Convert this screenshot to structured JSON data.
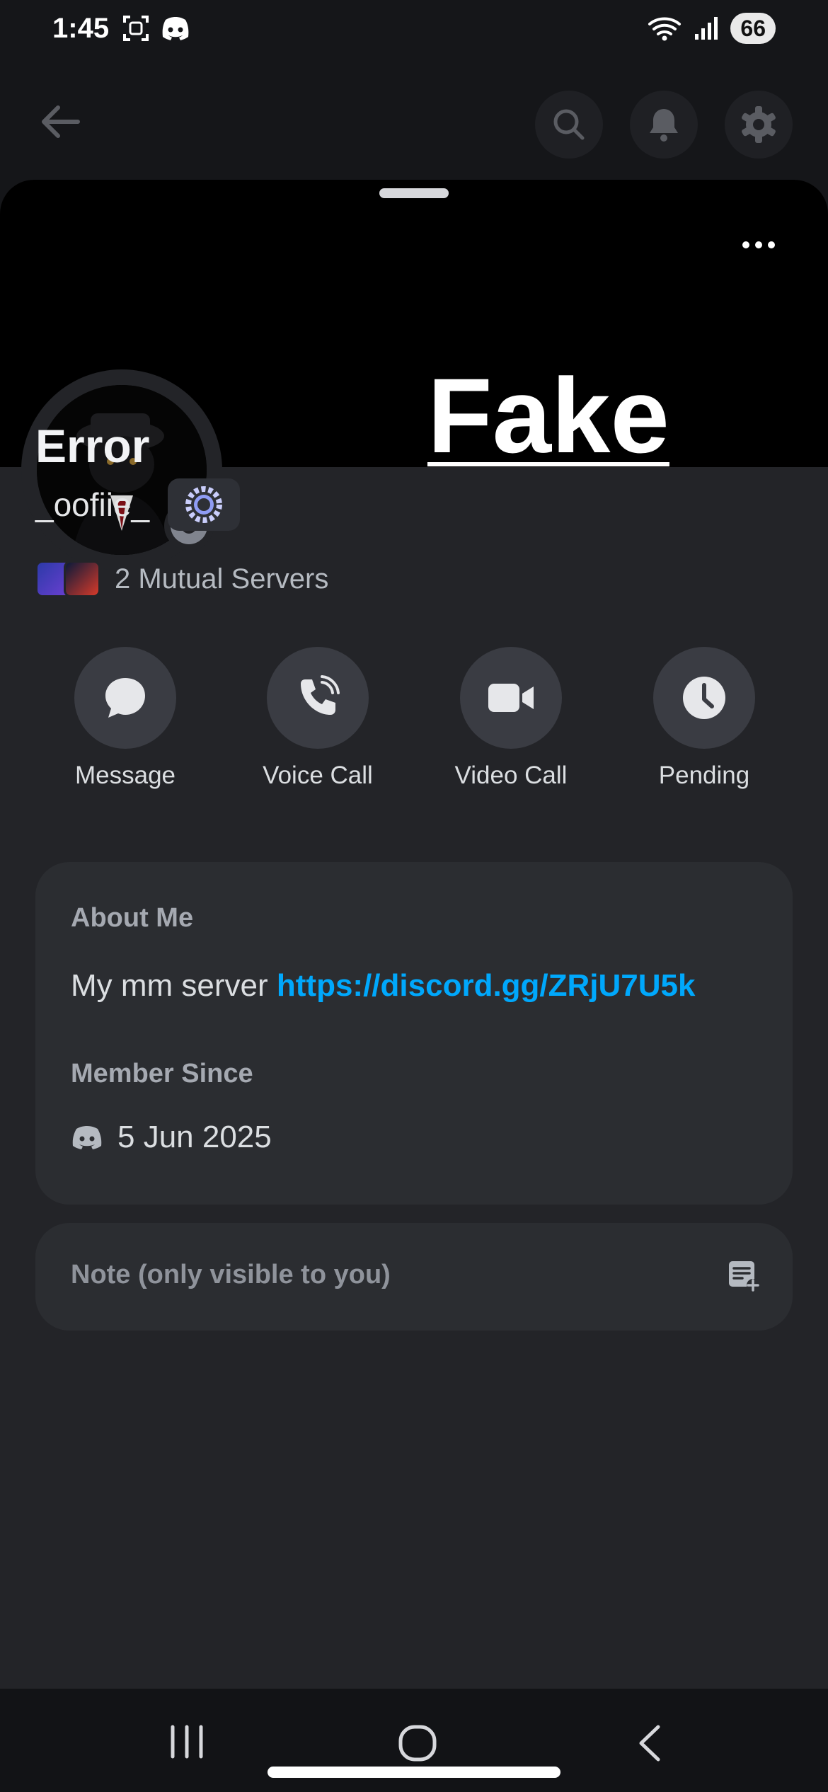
{
  "status_bar": {
    "time": "1:45",
    "battery": "66"
  },
  "profile": {
    "display_name": "Error",
    "username": "_oofiie_",
    "mutual_servers": "2 Mutual Servers",
    "overlay_text": "Fake"
  },
  "actions": [
    {
      "label": "Message",
      "icon": "chat-bubble-icon"
    },
    {
      "label": "Voice Call",
      "icon": "phone-call-icon"
    },
    {
      "label": "Video Call",
      "icon": "video-camera-icon"
    },
    {
      "label": "Pending",
      "icon": "clock-icon"
    }
  ],
  "about": {
    "title": "About Me",
    "text_prefix": "My mm server ",
    "link": "https://discord.gg/ZRjU7U5k"
  },
  "member_since": {
    "title": "Member Since",
    "date": "5 Jun 2025"
  },
  "note": {
    "placeholder": "Note (only visible to you)"
  },
  "colors": {
    "background": "#151619",
    "sheet": "#232428",
    "card": "#2b2d31",
    "link": "#00a8fc",
    "status_offline": "#80848e"
  }
}
